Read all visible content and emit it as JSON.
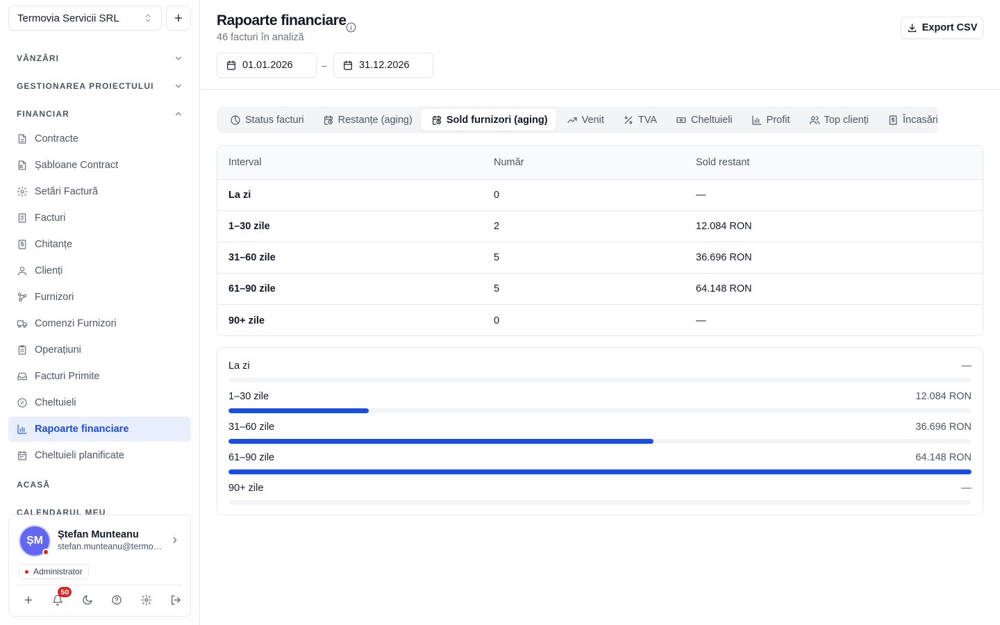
{
  "org": {
    "name": "Termovia Servicii SRL"
  },
  "sidebar": {
    "sections": [
      {
        "label": "VÂNZĂRI"
      },
      {
        "label": "GESTIONAREA PROIECTULUI"
      },
      {
        "label": "FINANCIAR"
      },
      {
        "label": "ACASĂ"
      },
      {
        "label": "CALENDARUL MEU"
      }
    ],
    "items": [
      {
        "label": "Contracte",
        "icon": "document-icon"
      },
      {
        "label": "Șabloane Contract",
        "icon": "document-template-icon"
      },
      {
        "label": "Setări Factură",
        "icon": "gear-icon"
      },
      {
        "label": "Facturi",
        "icon": "invoice-icon"
      },
      {
        "label": "Chitanțe",
        "icon": "receipt-icon"
      },
      {
        "label": "Clienți",
        "icon": "user-icon"
      },
      {
        "label": "Furnizori",
        "icon": "nodes-icon"
      },
      {
        "label": "Comenzi Furnizori",
        "icon": "truck-icon"
      },
      {
        "label": "Operațiuni",
        "icon": "clipboard-icon"
      },
      {
        "label": "Facturi Primite",
        "icon": "inbox-icon"
      },
      {
        "label": "Cheltuieli",
        "icon": "gauge-icon"
      },
      {
        "label": "Rapoarte financiare",
        "icon": "bar-chart-icon",
        "active": true
      },
      {
        "label": "Cheltuieli planificate",
        "icon": "calendar-icon"
      }
    ]
  },
  "user": {
    "initials": "ȘM",
    "name": "Ștefan Munteanu",
    "email": "stefan.munteanu@termovia.ro",
    "role": "Administrator",
    "notifications": "50"
  },
  "header": {
    "title": "Rapoarte financiare",
    "subtitle": "46 facturi în analiză",
    "export_label": "Export CSV",
    "date_from": "01.01.2026",
    "date_to": "31.12.2026",
    "date_separator": "–"
  },
  "tabs": [
    {
      "label": "Status facturi",
      "icon": "pie-icon"
    },
    {
      "label": "Restanțe (aging)",
      "icon": "calendar-clock-icon"
    },
    {
      "label": "Sold furnizori (aging)",
      "icon": "calendar-clock-icon",
      "active": true
    },
    {
      "label": "Venit",
      "icon": "trend-up-icon"
    },
    {
      "label": "TVA",
      "icon": "percent-icon"
    },
    {
      "label": "Cheltuieli",
      "icon": "banknote-icon"
    },
    {
      "label": "Profit",
      "icon": "bar-chart-icon"
    },
    {
      "label": "Top clienți",
      "icon": "users-icon"
    },
    {
      "label": "Încasări",
      "icon": "receipt-icon"
    }
  ],
  "table": {
    "columns": [
      "Interval",
      "Număr",
      "Sold restant"
    ],
    "rows": [
      {
        "interval": "La zi",
        "count": "0",
        "balance": "—"
      },
      {
        "interval": "1–30 zile",
        "count": "2",
        "balance": "12.084 RON"
      },
      {
        "interval": "31–60 zile",
        "count": "5",
        "balance": "36.696 RON"
      },
      {
        "interval": "61–90 zile",
        "count": "5",
        "balance": "64.148 RON"
      },
      {
        "interval": "90+ zile",
        "count": "0",
        "balance": "—"
      }
    ]
  },
  "bars": [
    {
      "label": "La zi",
      "value_text": "—",
      "fraction": 0
    },
    {
      "label": "1–30 zile",
      "value_text": "12.084 RON",
      "fraction": 0.1884
    },
    {
      "label": "31–60 zile",
      "value_text": "36.696 RON",
      "fraction": 0.5721
    },
    {
      "label": "61–90 zile",
      "value_text": "64.148 RON",
      "fraction": 1.0
    },
    {
      "label": "90+ zile",
      "value_text": "—",
      "fraction": 0
    }
  ],
  "colors": {
    "accent": "#1d4ed8",
    "active_nav_bg": "#e8eefc",
    "danger": "#dc2626",
    "avatar": "#6366f1"
  }
}
